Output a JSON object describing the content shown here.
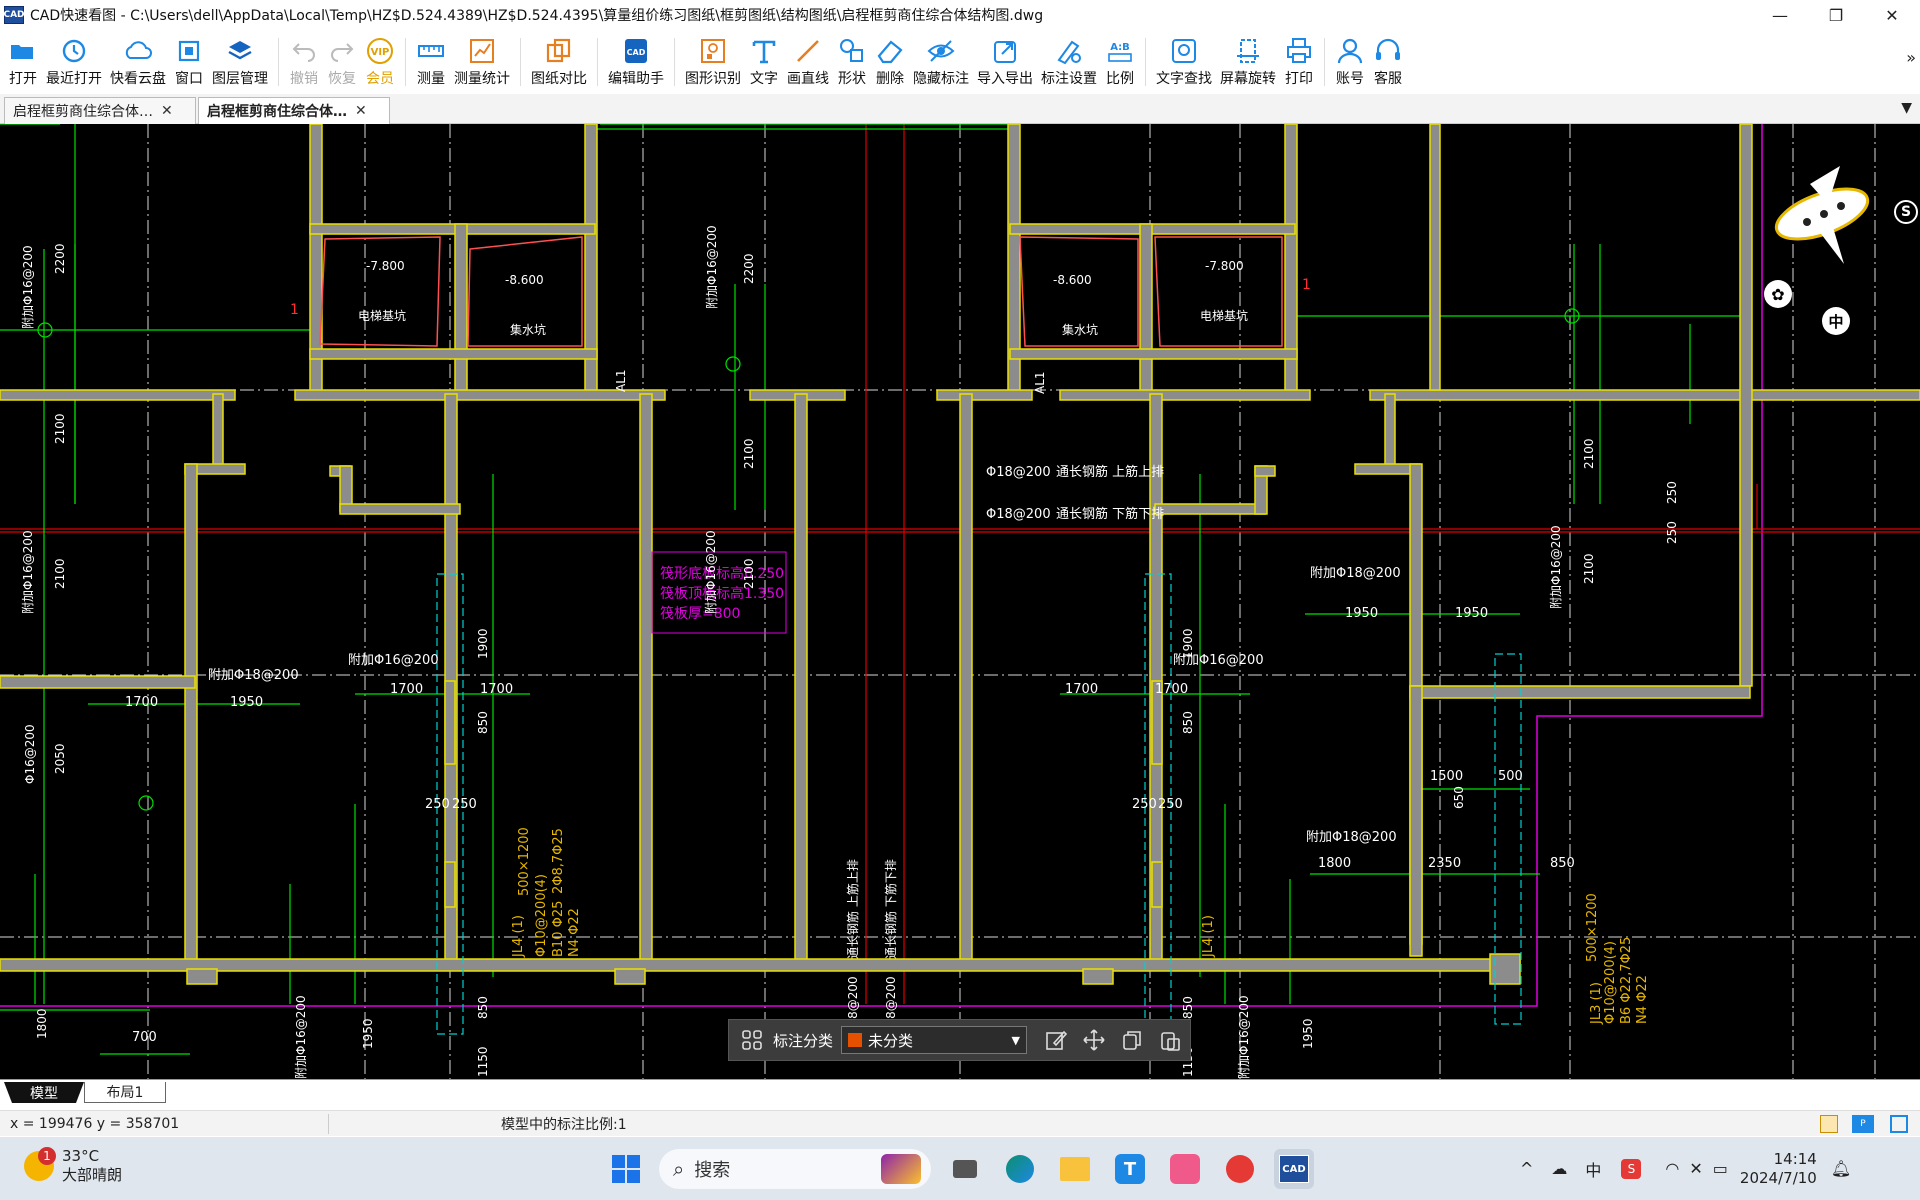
{
  "window": {
    "logo_text": "CAD",
    "title": "CAD快速看图 - C:\\Users\\dell\\AppData\\Local\\Temp\\HZ$D.524.4389\\HZ$D.524.4395\\算量组价练习图纸\\框剪图纸\\结构图纸\\启程框剪商住综合体结构图.dwg",
    "controls": [
      "—",
      "❐",
      "✕"
    ]
  },
  "toolbar": {
    "items": [
      {
        "label": "打开",
        "icon": "folder-open-icon"
      },
      {
        "label": "最近打开",
        "icon": "clock-history-icon"
      },
      {
        "label": "快看云盘",
        "icon": "cloud-icon"
      },
      {
        "label": "窗口",
        "icon": "window-icon"
      },
      {
        "label": "图层管理",
        "icon": "layers-icon"
      },
      {
        "label": "撤销",
        "icon": "undo-icon"
      },
      {
        "label": "恢复",
        "icon": "redo-icon"
      },
      {
        "label": "会员",
        "icon": "vip-icon"
      },
      {
        "label": "测量",
        "icon": "ruler-icon"
      },
      {
        "label": "测量统计",
        "icon": "measure-stats-icon"
      },
      {
        "label": "图纸对比",
        "icon": "compare-icon"
      },
      {
        "label": "编辑助手",
        "icon": "edit-assistant-icon"
      },
      {
        "label": "图形识别",
        "icon": "shape-recognize-icon"
      },
      {
        "label": "文字",
        "icon": "text-icon"
      },
      {
        "label": "画直线",
        "icon": "line-icon"
      },
      {
        "label": "形状",
        "icon": "shapes-icon"
      },
      {
        "label": "删除",
        "icon": "eraser-icon"
      },
      {
        "label": "隐藏标注",
        "icon": "eye-hide-icon"
      },
      {
        "label": "导入导出",
        "icon": "import-export-icon"
      },
      {
        "label": "标注设置",
        "icon": "annotation-settings-icon"
      },
      {
        "label": "比例",
        "icon": "scale-icon"
      },
      {
        "label": "文字查找",
        "icon": "text-search-icon"
      },
      {
        "label": "屏幕旋转",
        "icon": "rotate-screen-icon"
      },
      {
        "label": "打印",
        "icon": "printer-icon"
      },
      {
        "label": "账号",
        "icon": "user-icon"
      },
      {
        "label": "客服",
        "icon": "headset-icon"
      }
    ],
    "vip_icon_text": "VIP",
    "scale_icon_text": "A:B",
    "more": "»"
  },
  "tabs": [
    {
      "label": "启程框剪商住综合体…",
      "active": false
    },
    {
      "label": "启程框剪商住综合体…",
      "active": true
    }
  ],
  "drawing": {
    "room_labels": [
      {
        "level": "-7.800",
        "name": "电梯基坑"
      },
      {
        "level": "-8.600",
        "name": "集水坑"
      },
      {
        "level": "-8.600",
        "name": "集水坑"
      },
      {
        "level": "-7.800",
        "name": "电梯基坑"
      }
    ],
    "info_box": [
      "筏形底板标高6.250",
      "筏板顶板标高1.350",
      "筏板厚=800"
    ],
    "dims": [
      "2200",
      "2100",
      "2100",
      "2050",
      "1800",
      "700",
      "1700",
      "1950",
      "1950",
      "1700",
      "1700",
      "1900",
      "850",
      "850",
      "1150",
      "250",
      "250",
      "2200",
      "2100",
      "2100",
      "1900",
      "850",
      "850",
      "1150",
      "250",
      "250",
      "1700",
      "1700",
      "1950",
      "1950",
      "1500",
      "500",
      "1800",
      "2350",
      "850",
      "650",
      "250",
      "250",
      "2100",
      "2100"
    ],
    "rebar_labels": [
      "附加Φ16@200",
      "附加Φ16@200",
      "附加Φ16@200",
      "Φ16@200",
      "附加Φ18@200",
      "附加Φ16@200",
      "附加Φ16@200",
      "附加Φ16@200",
      "Φ18@200",
      "通长钢筋 上筋上排",
      "Φ18@200",
      "通长钢筋 下筋下排",
      "附加Φ18@200",
      "附加Φ16@200",
      "附加Φ18@200",
      "附加Φ16@200",
      "附加Φ16@200",
      "Φ18@200",
      "Φ18@200",
      "通长钢筋 上筋上排",
      "通长钢筋 下筋下排"
    ],
    "beam_notes": [
      "JL4 (1)",
      "500×1200",
      "Φ10@200(4)",
      "2Φ8,7Φ25",
      "B10 Φ25",
      "N4 Φ22",
      "JL4 (1)",
      "JL3 (1)",
      "500×1200",
      "Φ10@200(4)",
      "B6 Φ22,7Φ25",
      "N4 Φ22"
    ],
    "axis_marks": [
      "AL1",
      "AL1",
      "1",
      "1"
    ]
  },
  "float_bar": {
    "label": "标注分类",
    "select_value": "未分类",
    "swatch_color": "#e65100"
  },
  "side_widgets": {
    "badge_s": "S",
    "badge_zh": "中"
  },
  "layout_tabs": [
    "模型",
    "布局1"
  ],
  "status": {
    "coords": "x = 199476  y = 358701",
    "scale_text": "模型中的标注比例:1"
  },
  "taskbar": {
    "weather_temp": "33°C",
    "weather_desc": "大部晴朗",
    "weather_badge": "1",
    "search_placeholder": "搜索",
    "ime": "中",
    "time": "14:14",
    "date": "2024/7/10"
  },
  "colors": {
    "wall_fill": "#8c8c8c",
    "wall_edge": "#e8e000",
    "dim_green": "#00e000",
    "axis_red": "#e00000",
    "magenta": "#e000e0",
    "cyan": "#00d0d0",
    "beam_text": "#e6b800"
  }
}
